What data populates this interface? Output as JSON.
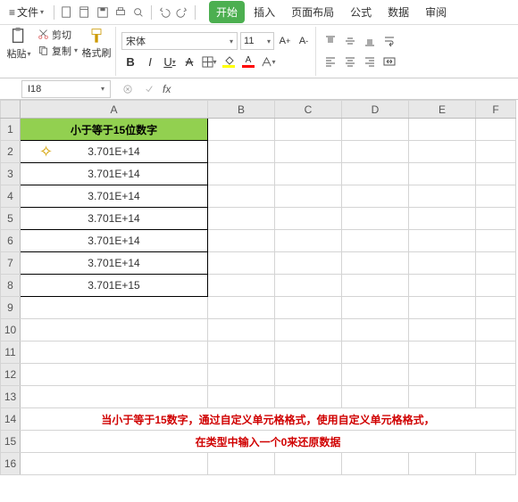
{
  "menubar": {
    "file_label": "文件",
    "tabs": [
      "开始",
      "插入",
      "页面布局",
      "公式",
      "数据",
      "审阅"
    ]
  },
  "clipboard": {
    "paste": "粘贴",
    "cut": "剪切",
    "copy": "复制",
    "format_painter": "格式刷"
  },
  "font": {
    "name": "宋体",
    "size": "11",
    "bold": "B",
    "italic": "I",
    "underline": "U",
    "strike": "A"
  },
  "namebox": {
    "ref": "I18"
  },
  "fx": {
    "label": "fx"
  },
  "columns": [
    "A",
    "B",
    "C",
    "D",
    "E",
    "F"
  ],
  "rows": [
    "1",
    "2",
    "3",
    "4",
    "5",
    "6",
    "7",
    "8",
    "9",
    "10",
    "11",
    "12",
    "13",
    "14",
    "15",
    "16"
  ],
  "sheet": {
    "header": "小于等于15位数字",
    "data": [
      "3.701E+14",
      "3.701E+14",
      "3.701E+14",
      "3.701E+14",
      "3.701E+14",
      "3.701E+14",
      "3.701E+15"
    ],
    "note_line1": "当小于等于15数字，通过自定义单元格格式，使用自定义单元格格式，",
    "note_line2": "在类型中输入一个0来还原数据"
  }
}
